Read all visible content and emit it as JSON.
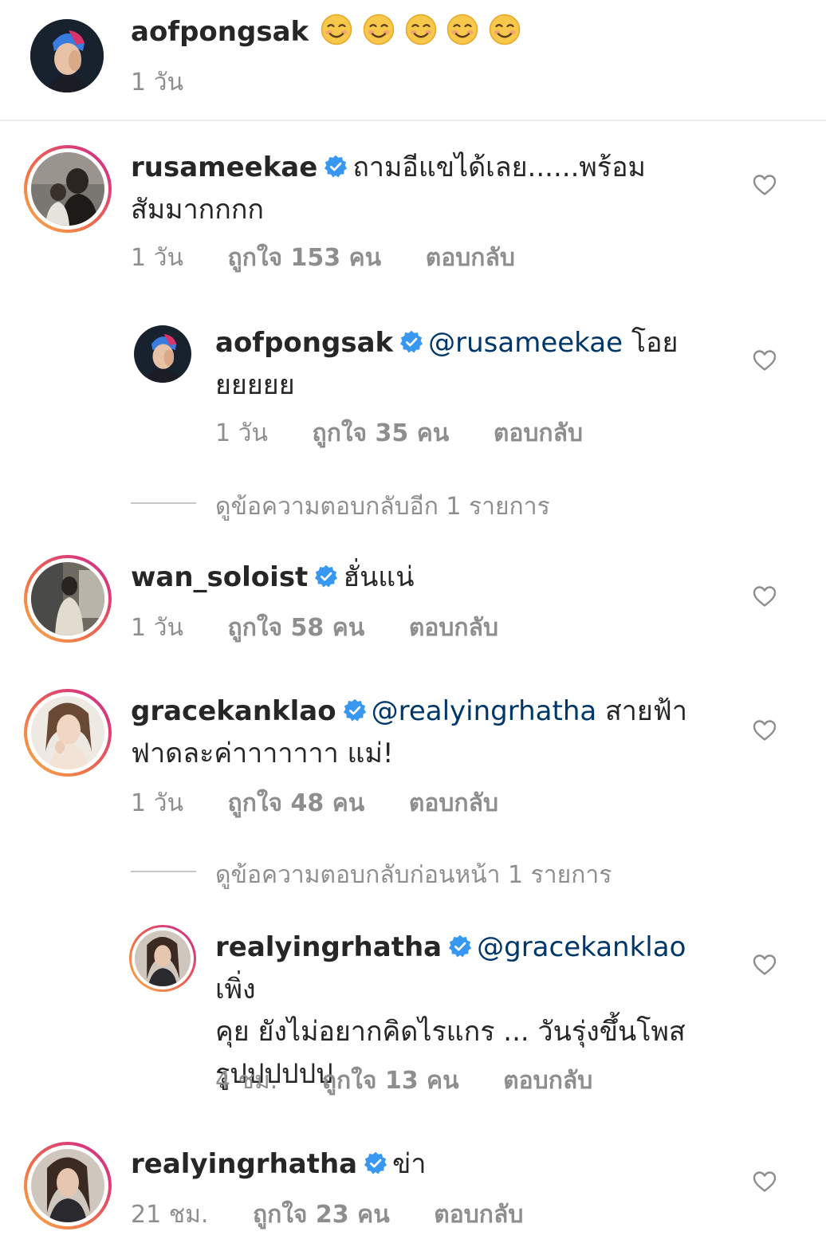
{
  "caption": {
    "username": "aofpongsak",
    "emojis": [
      "😊",
      "😊",
      "😊",
      "😊",
      "😊"
    ],
    "time": "1 วัน"
  },
  "comments": [
    {
      "username": "rusameekae",
      "verified": true,
      "text_line1": "ถามอีแขได้เลย......พร้อม",
      "text_line2": "สัมมากกกก",
      "time": "1 วัน",
      "likes": "ถูกใจ 153 คน",
      "reply": "ตอบกลับ"
    },
    {
      "username": "aofpongsak",
      "verified": true,
      "mention": "@rusameekae",
      "text_line1": " โอย",
      "text_line2": "ยยยยย",
      "time": "1 วัน",
      "likes": "ถูกใจ 35 คน",
      "reply": "ตอบกลับ"
    },
    {
      "more_replies": "ดูข้อความตอบกลับอีก 1 รายการ"
    },
    {
      "username": "wan_soloist",
      "verified": true,
      "text_line1": "ฮั่นแน่",
      "time": "1 วัน",
      "likes": "ถูกใจ 58 คน",
      "reply": "ตอบกลับ"
    },
    {
      "username": "gracekanklao",
      "verified": true,
      "mention": "@realyingrhatha",
      "text_line1": " สายฟ้า",
      "text_line2": "ฟาดละค่าาาาาาา แม่!",
      "time": "1 วัน",
      "likes": "ถูกใจ 48 คน",
      "reply": "ตอบกลับ"
    },
    {
      "more_replies": "ดูข้อความตอบกลับก่อนหน้า 1 รายการ"
    },
    {
      "username": "realyingrhatha",
      "verified": true,
      "mention": "@gracekanklao",
      "text_line1": " เพิ่ง",
      "text_line2": "คุย ยังไม่อยากคิดไรแกร ... วันรุ่งขึ้นโพส",
      "text_line3": "รูปปปปปป",
      "time": "4 ชม.",
      "likes": "ถูกใจ 13 คน",
      "reply": "ตอบกลับ"
    },
    {
      "username": "realyingrhatha",
      "verified": true,
      "text_line1": "ข่า",
      "time": "21 ชม.",
      "likes": "ถูกใจ 23 คน",
      "reply": "ตอบกลับ"
    }
  ],
  "icons": {
    "verified": "verified-badge-icon",
    "heart": "heart-outline-icon"
  },
  "colors": {
    "verified": "#3897f0",
    "mention": "#00376b",
    "meta": "#8e8e8e"
  }
}
